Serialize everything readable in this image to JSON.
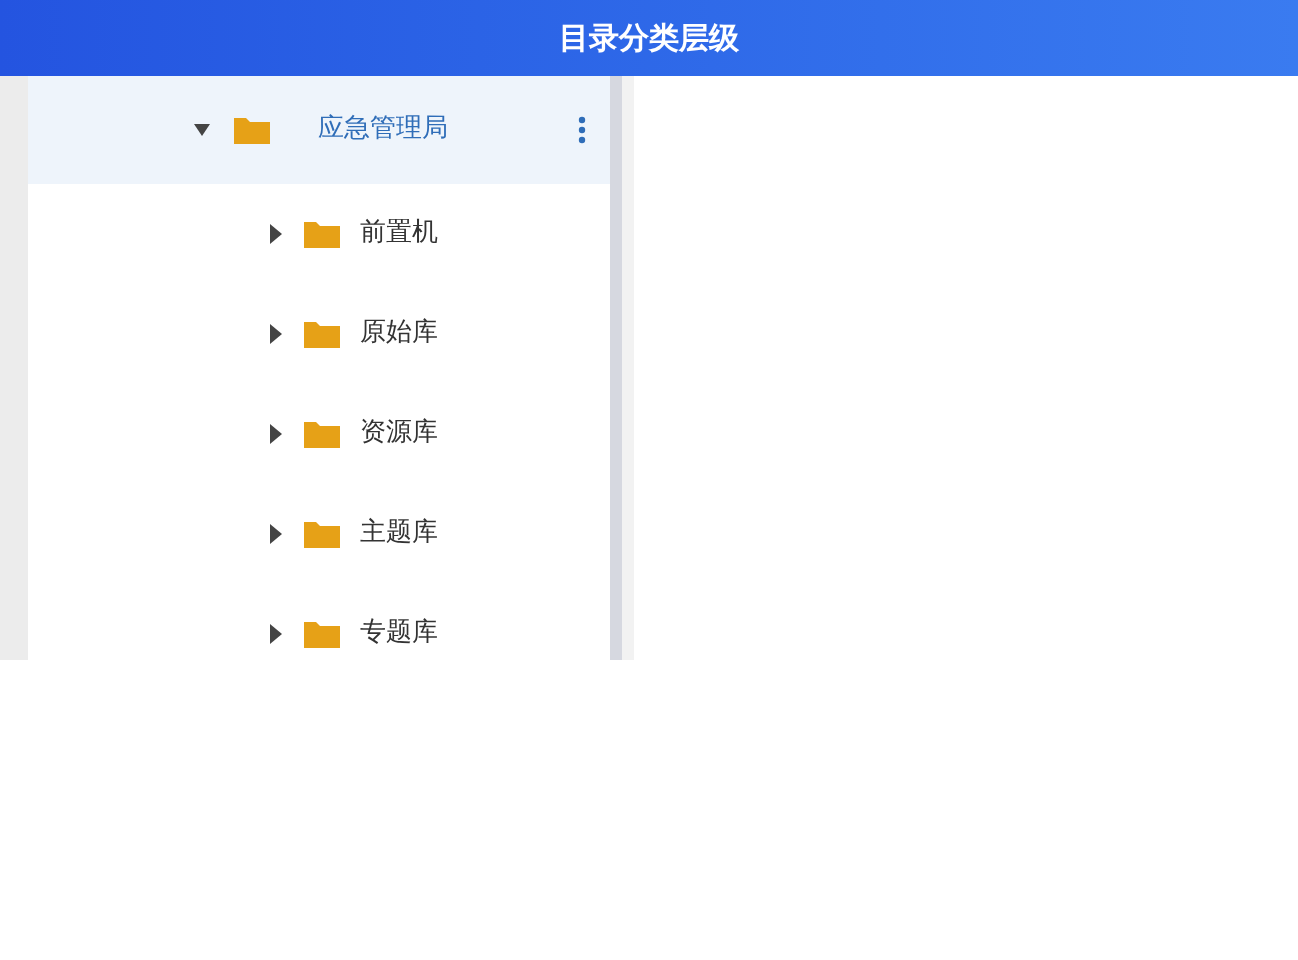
{
  "header": {
    "title": "目录分类层级"
  },
  "tree": [
    {
      "label": "应急管理局",
      "expanded": true,
      "selected": true,
      "children": [
        {
          "label": "前置机",
          "expanded": false,
          "selected": false
        },
        {
          "label": "原始库",
          "expanded": false,
          "selected": false
        },
        {
          "label": "资源库",
          "expanded": false,
          "selected": false
        },
        {
          "label": "主题库",
          "expanded": false,
          "selected": false
        },
        {
          "label": "专题库",
          "expanded": false,
          "selected": false
        }
      ]
    }
  ]
}
